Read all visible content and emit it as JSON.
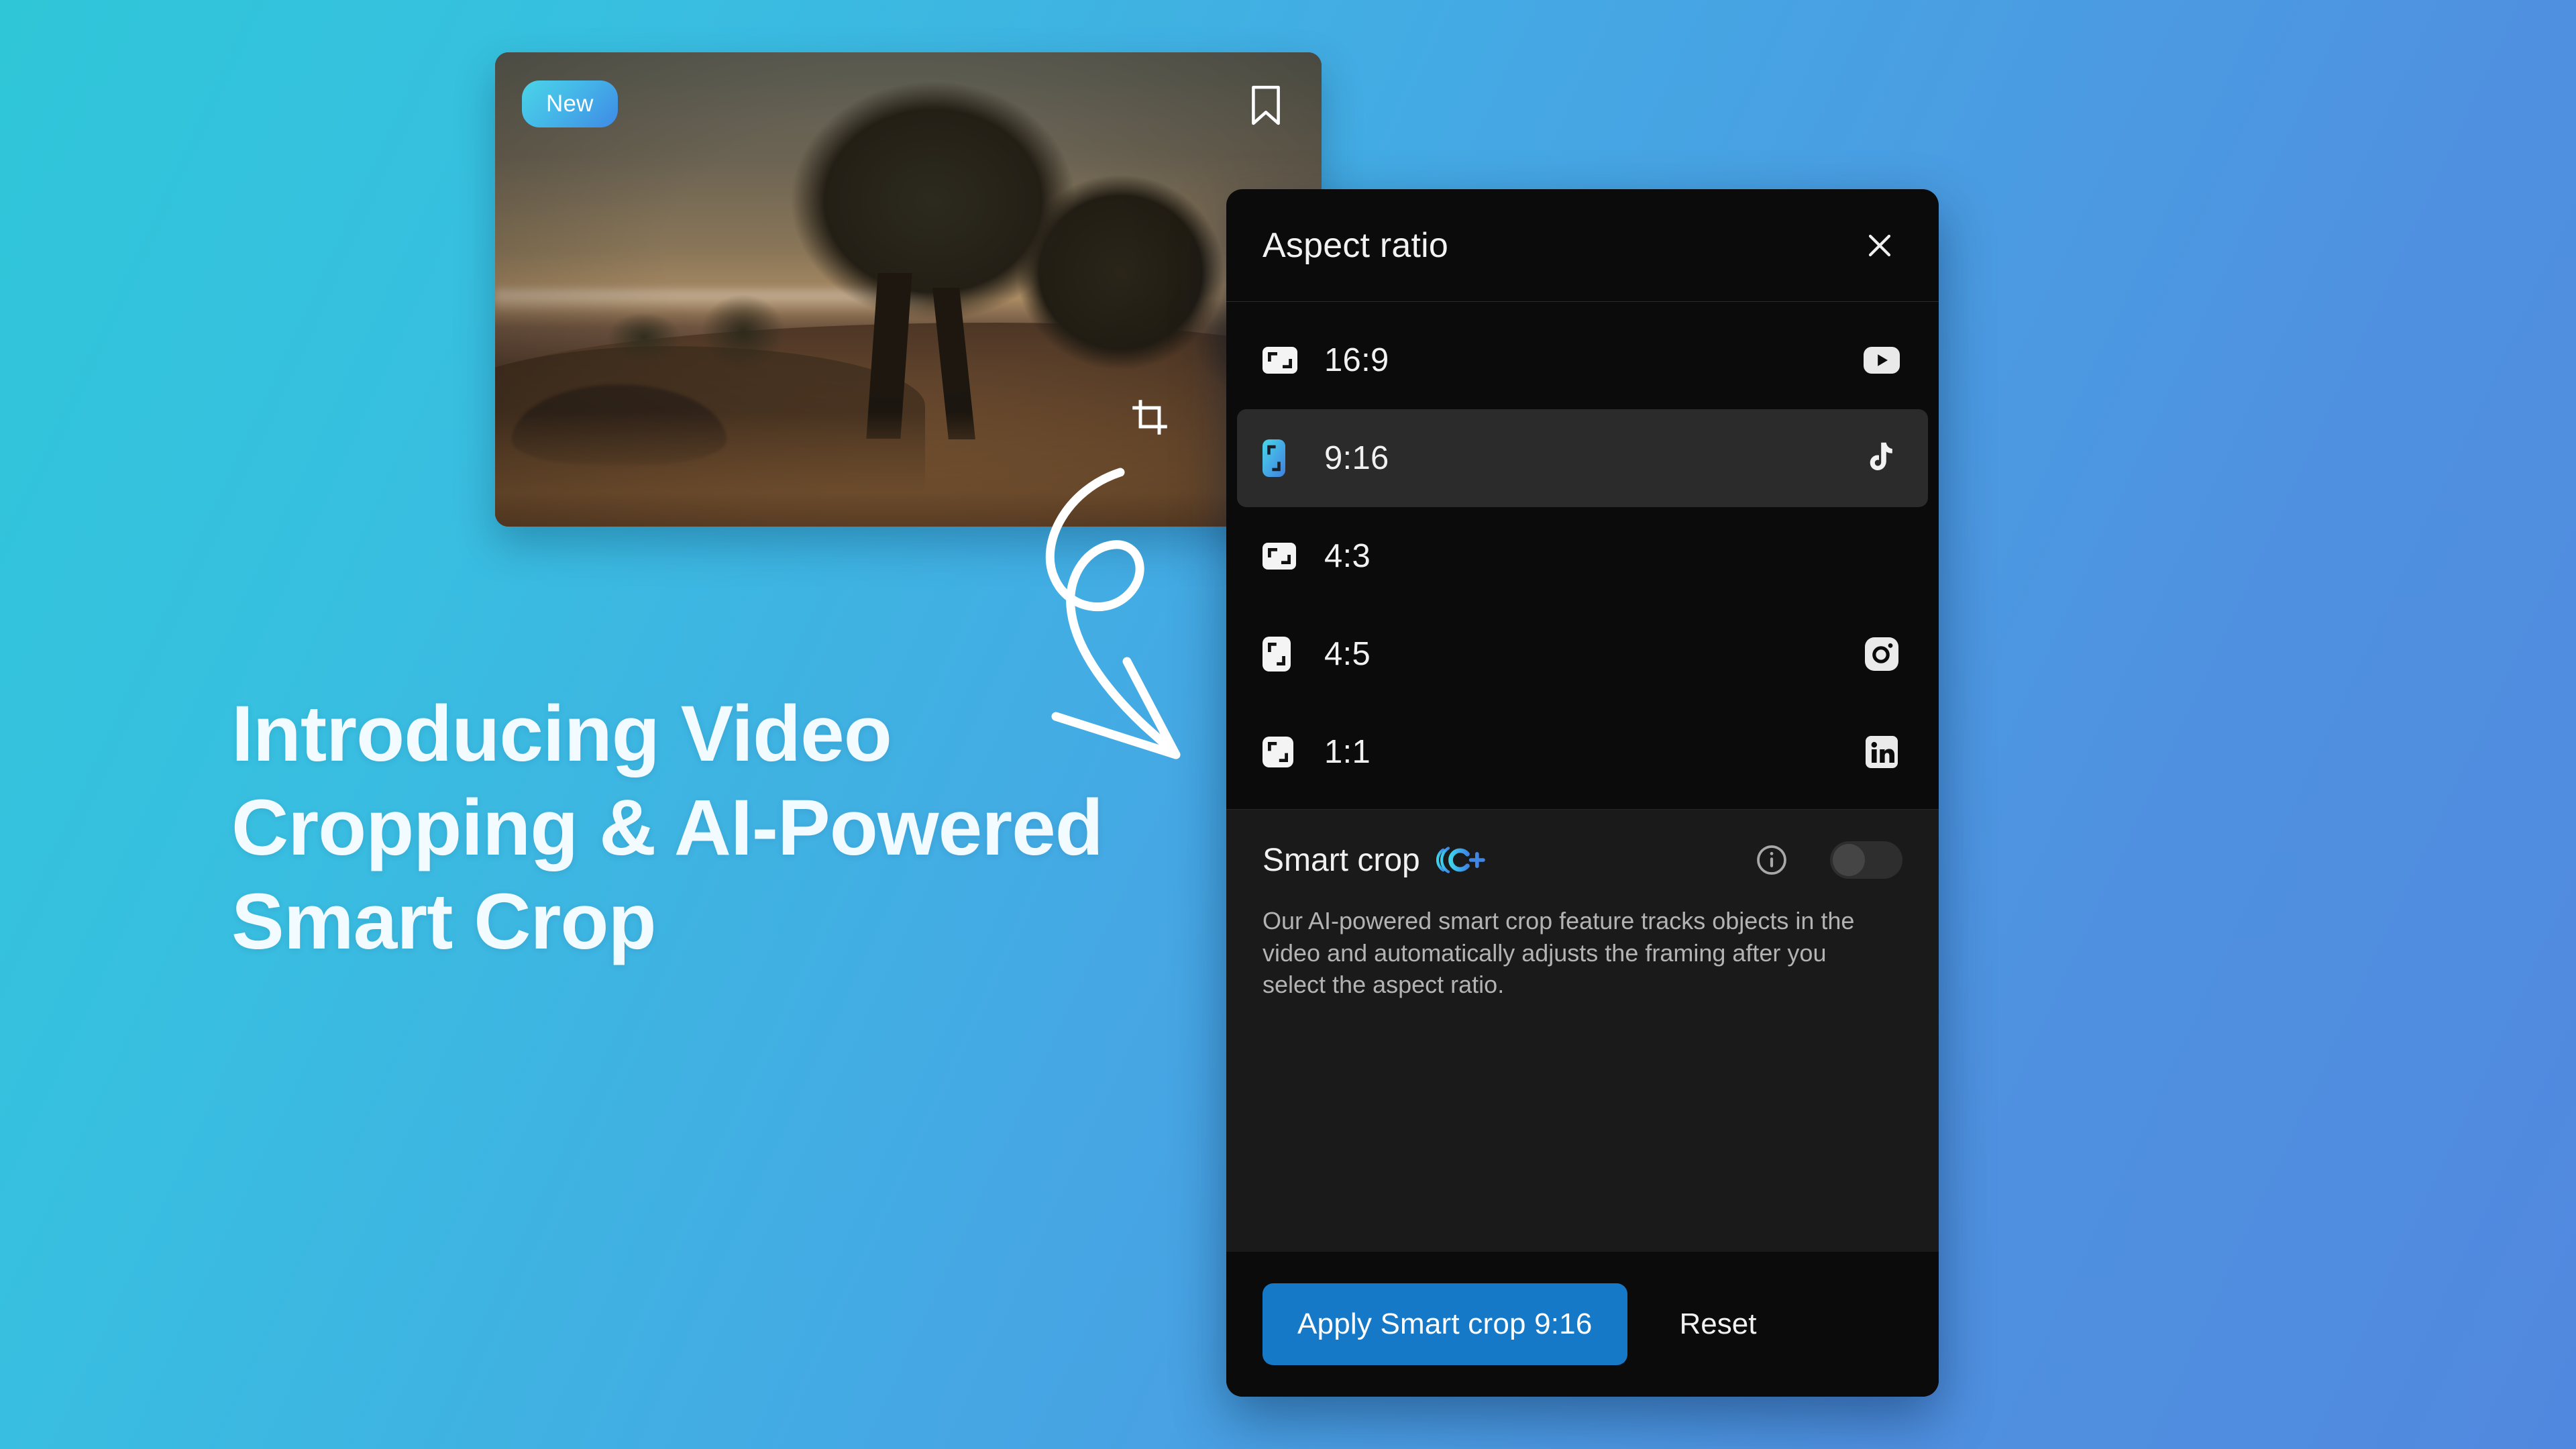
{
  "background": {
    "color_left": "#2fc6d8",
    "color_right": "#5188df"
  },
  "headline": {
    "line1": "Introducing Video",
    "line2": "Cropping & AI-Powered",
    "line3": "Smart Crop"
  },
  "video_card": {
    "badge": "New",
    "bookmark_icon": "bookmark-icon",
    "crop_icon": "crop-icon",
    "scene": "dusk hillside with silhouetted trees"
  },
  "annotation": {
    "icon": "curved-arrow-doodle"
  },
  "dialog": {
    "title": "Aspect ratio",
    "close_icon": "close-icon",
    "ratios": [
      {
        "label": "16:9",
        "icon": "aspect-landscape-icon",
        "social": "youtube-icon",
        "selected": false
      },
      {
        "label": "9:16",
        "icon": "aspect-portrait-icon",
        "social": "tiktok-icon",
        "selected": true
      },
      {
        "label": "4:3",
        "icon": "aspect-landscape-icon",
        "social": "",
        "selected": false
      },
      {
        "label": "4:5",
        "icon": "aspect-portrait-icon",
        "social": "instagram-icon",
        "selected": false
      },
      {
        "label": "1:1",
        "icon": "aspect-square-icon",
        "social": "linkedin-icon",
        "selected": false
      }
    ],
    "smart_crop": {
      "title": "Smart crop",
      "badge": "C+",
      "info_icon": "info-icon",
      "toggle_state": "off",
      "description": "Our AI-powered smart crop feature tracks objects in the video and automatically adjusts the framing after you select the aspect ratio."
    },
    "footer": {
      "apply_label": "Apply Smart crop 9:16",
      "apply_color": "#1579c8",
      "reset_label": "Reset"
    }
  }
}
